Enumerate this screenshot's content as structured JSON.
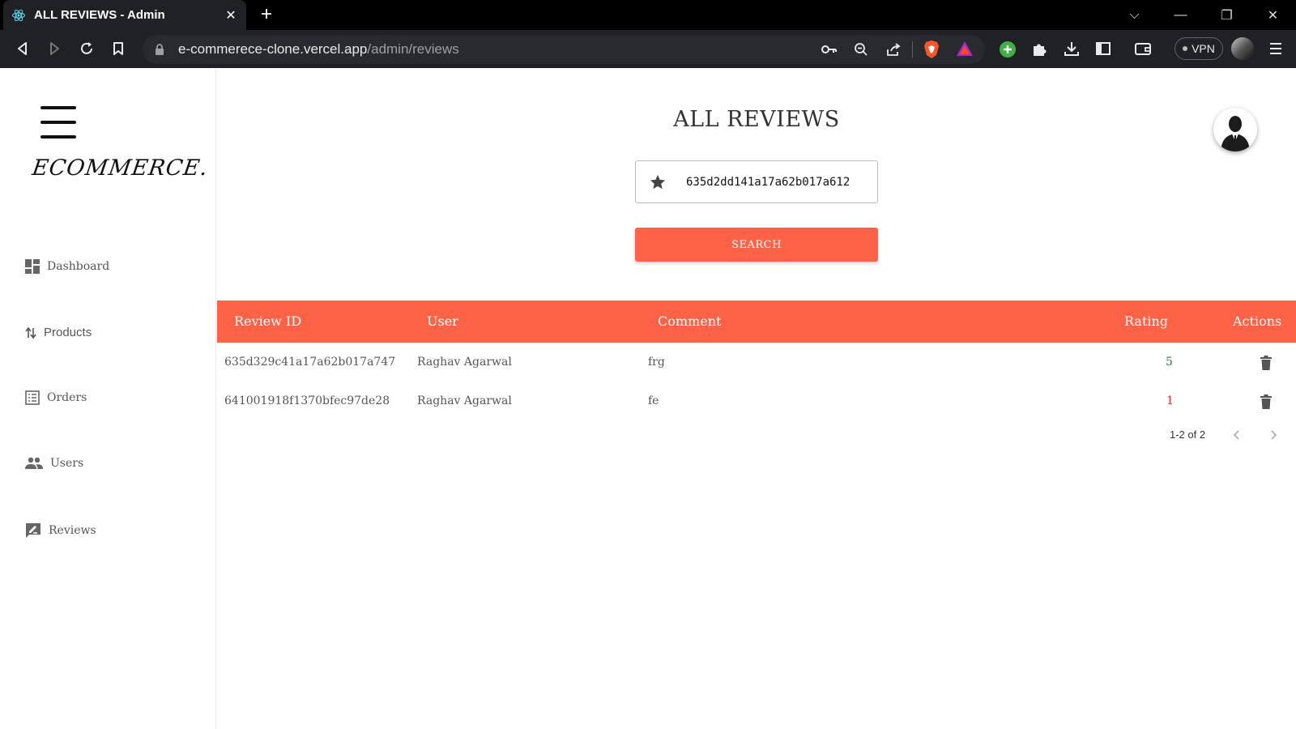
{
  "browser": {
    "tab_title": "ALL REVIEWS - Admin",
    "tab_close": "✕",
    "new_tab": "+",
    "url_host": "e-commerece-clone.vercel.app",
    "url_path": "/admin/reviews",
    "vpn_label": "VPN",
    "win_chevron": "⌵",
    "win_minimize": "—",
    "win_restore": "❐",
    "win_close": "✕"
  },
  "sidebar": {
    "logo": "ECOMMERCE.",
    "items": [
      {
        "label": "Dashboard",
        "icon": "dashboard-icon"
      },
      {
        "label": "Products",
        "icon": "sort-arrows-icon"
      },
      {
        "label": "Orders",
        "icon": "list-icon"
      },
      {
        "label": "Users",
        "icon": "people-icon"
      },
      {
        "label": "Reviews",
        "icon": "rate-review-icon"
      }
    ]
  },
  "main": {
    "heading": "ALL REVIEWS",
    "search_value": "635d2dd141a17a62b017a612",
    "search_button": "SEARCH"
  },
  "table": {
    "headers": [
      "Review ID",
      "User",
      "Comment",
      "Rating",
      "Actions"
    ],
    "rows": [
      {
        "id": "635d329c41a17a62b017a747",
        "user": "Raghav Agarwal",
        "comment": "frg",
        "rating": "5",
        "rating_color": "#2e7d32"
      },
      {
        "id": "641001918f1370bfec97de28",
        "user": "Raghav Agarwal",
        "comment": "fe",
        "rating": "1",
        "rating_color": "#d32f2f"
      }
    ],
    "pagination": "1-2 of 2"
  },
  "colors": {
    "accent": "#ff6347",
    "chrome_dark": "#202124"
  }
}
